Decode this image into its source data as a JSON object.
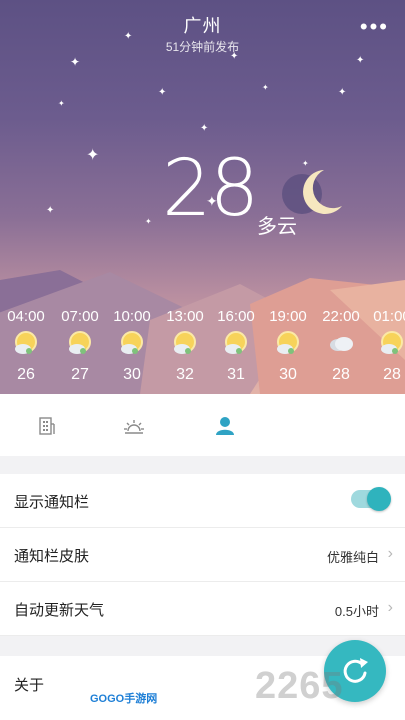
{
  "header": {
    "city": "广州",
    "updated": "51分钟前发布",
    "more_icon": "more-dots-icon"
  },
  "current": {
    "temperature": "28",
    "condition": "多云",
    "icon": "crescent-moon-cloud-icon"
  },
  "hourly": [
    {
      "time": "04:00",
      "temp": "26",
      "icon": "partly-cloudy-sun-icon"
    },
    {
      "time": "07:00",
      "temp": "27",
      "icon": "partly-cloudy-sun-icon"
    },
    {
      "time": "10:00",
      "temp": "30",
      "icon": "partly-cloudy-sun-icon"
    },
    {
      "time": "13:00",
      "temp": "32",
      "icon": "partly-cloudy-sun-icon"
    },
    {
      "time": "16:00",
      "temp": "31",
      "icon": "partly-cloudy-sun-icon"
    },
    {
      "time": "19:00",
      "temp": "30",
      "icon": "partly-cloudy-sun-icon"
    },
    {
      "time": "22:00",
      "temp": "28",
      "icon": "cloudy-icon"
    },
    {
      "time": "01:00",
      "temp": "28",
      "icon": "partly-cloudy-sun-icon"
    }
  ],
  "tabs": [
    {
      "icon": "building-icon",
      "active": false
    },
    {
      "icon": "sun-icon",
      "active": false
    },
    {
      "icon": "user-icon",
      "active": true
    }
  ],
  "settings": {
    "show_notification": {
      "label": "显示通知栏",
      "enabled": true
    },
    "notification_skin": {
      "label": "通知栏皮肤",
      "value": "优雅纯白"
    },
    "auto_update": {
      "label": "自动更新天气",
      "value": "0.5小时"
    },
    "about": {
      "label": "关于"
    }
  },
  "fab_icon": "refresh-icon",
  "watermarks": {
    "left": "GOGO手游网",
    "right": "2265"
  },
  "colors": {
    "accent": "#35b8c0",
    "sky_top": "#5d5184",
    "sky_bottom": "#e3b3a8"
  }
}
